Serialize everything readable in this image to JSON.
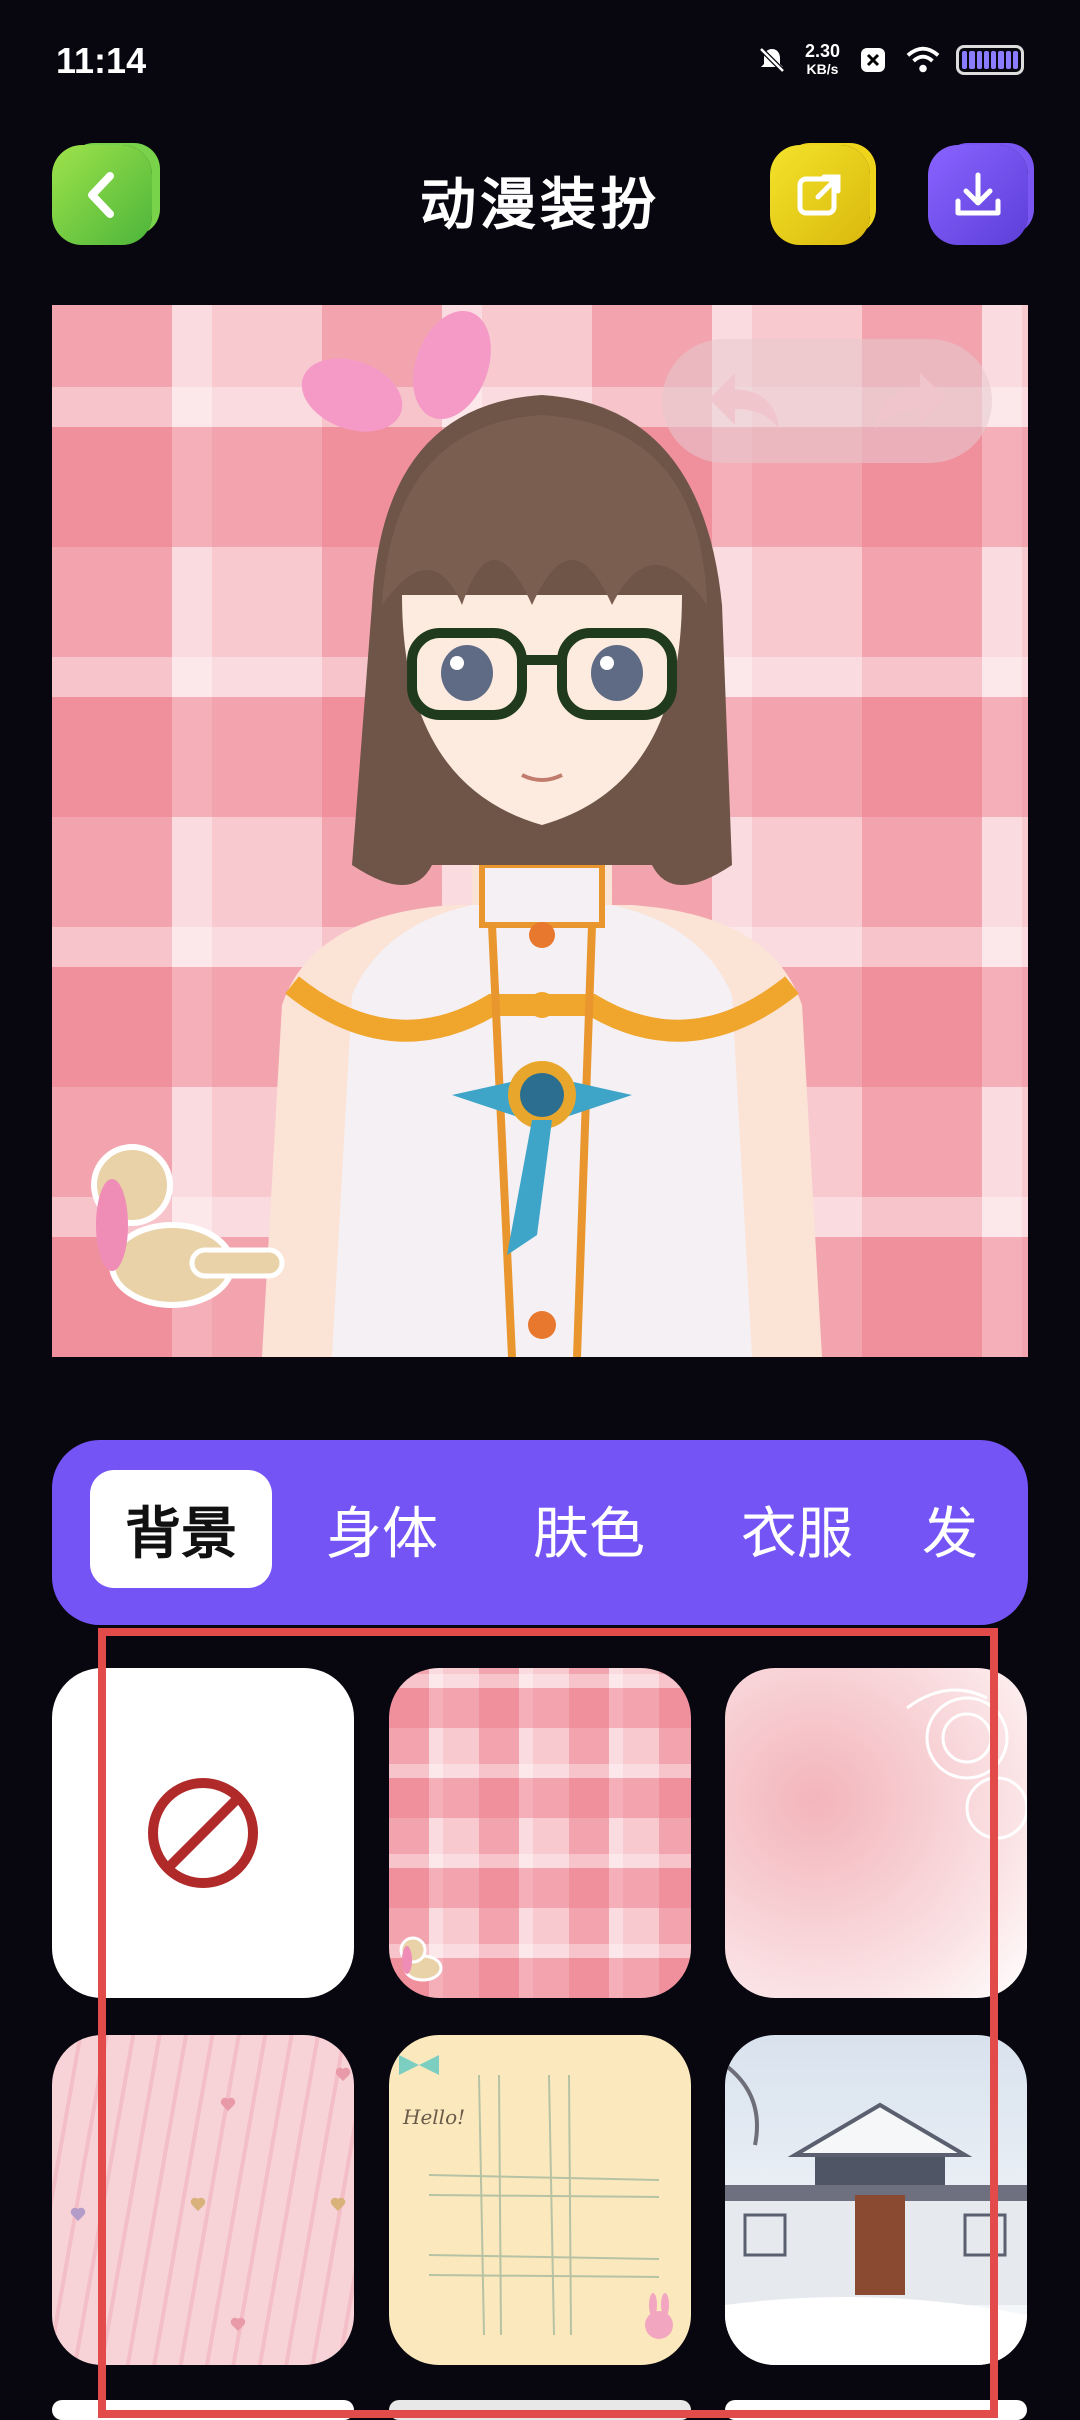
{
  "status": {
    "time": "11:14",
    "net_speed_value": "2.30",
    "net_speed_unit": "KB/s",
    "icons": [
      "bell-muted-icon",
      "x-app-icon",
      "wifi-icon",
      "battery-icon"
    ]
  },
  "header": {
    "title": "动漫装扮",
    "back_icon": "chevron-left-icon",
    "share_icon": "share-external-icon",
    "download_icon": "download-icon"
  },
  "canvas": {
    "undo_icon": "undo-arrow-icon",
    "redo_icon": "redo-arrow-icon"
  },
  "tabs": [
    {
      "label": "背景",
      "active": true
    },
    {
      "label": "身体",
      "active": false
    },
    {
      "label": "肤色",
      "active": false
    },
    {
      "label": "衣服",
      "active": false
    },
    {
      "label": "发",
      "active": false
    }
  ],
  "backgrounds": {
    "tiles": [
      {
        "name": "none",
        "icon": "no-symbol-icon"
      },
      {
        "name": "pink-plaid"
      },
      {
        "name": "pink-watercolor"
      },
      {
        "name": "pink-wave-hearts"
      },
      {
        "name": "yellow-grid-hello",
        "text": "Hello!"
      },
      {
        "name": "snow-gate"
      }
    ]
  },
  "colors": {
    "accent": "#7554f6",
    "highlight_border": "#e34b4b",
    "back_button": "#6fcf45",
    "share_button": "#e8c918",
    "download_button": "#6e4cec"
  }
}
